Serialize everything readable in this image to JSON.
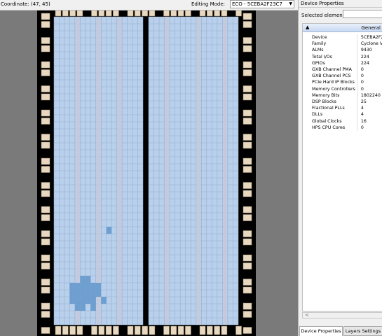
{
  "toolbar": {
    "coordinate": "Coordinate: (47, 45)",
    "editing_mode_label": "Editing Mode:",
    "editing_mode_value": "ECO - 5CEBA2F23C7"
  },
  "panel": {
    "title": "Device Properties",
    "selected_label": "Selected elements:",
    "selected_value": "",
    "group": {
      "toggle": "▲",
      "name": "General"
    },
    "properties": [
      {
        "key": "Device",
        "value": "5CEBA2F23C7*"
      },
      {
        "key": "Family",
        "value": "Cyclone V"
      },
      {
        "key": "ALMs",
        "value": "9430"
      },
      {
        "key": "Total I/Os",
        "value": "224"
      },
      {
        "key": "GPIOs",
        "value": "224"
      },
      {
        "key": "GXB Channel PMA",
        "value": "0"
      },
      {
        "key": "GXB Channel PCS",
        "value": "0"
      },
      {
        "key": "PCIe Hard IP Blocks",
        "value": "0"
      },
      {
        "key": "Memory Controllers",
        "value": "0"
      },
      {
        "key": "Memory Bits",
        "value": "1802240"
      },
      {
        "key": "DSP Blocks",
        "value": "25"
      },
      {
        "key": "Fractional PLLs",
        "value": "4"
      },
      {
        "key": "DLLs",
        "value": "4"
      },
      {
        "key": "Global Clocks",
        "value": "16"
      },
      {
        "key": "HPS CPU Cores",
        "value": "0"
      }
    ],
    "scroll_left": "<",
    "tabs": [
      "Device Properties",
      "Layers Settings"
    ]
  },
  "colors": {
    "lab": "#b8d0ec",
    "lab_used": "#6f9fd0",
    "column": "#c5c9dc",
    "io": "#e8d8c0",
    "chip": "#000000",
    "background": "#7a7a7a"
  },
  "icons": {
    "dropdown": "chevron-down-icon"
  }
}
